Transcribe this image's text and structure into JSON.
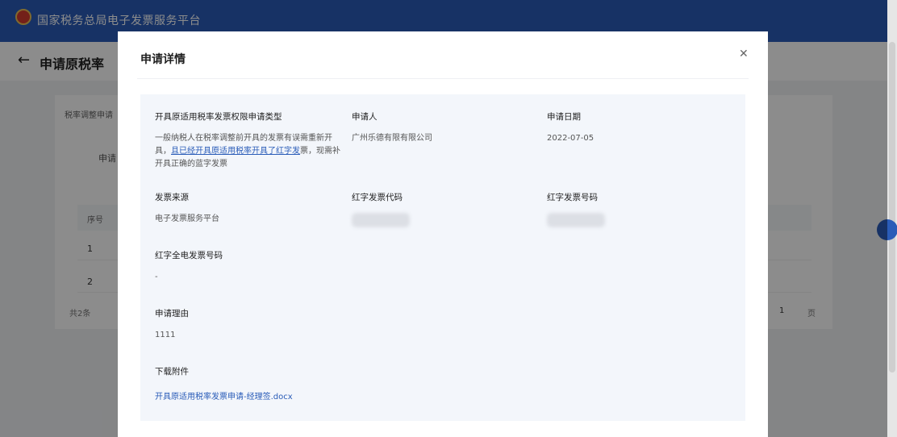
{
  "app": {
    "title": "国家税务总局电子发票服务平台"
  },
  "page": {
    "title": "申请原税率"
  },
  "background": {
    "tab_label": "税率调整申请",
    "field_label": "申请",
    "table_header_index": "序号",
    "rows": [
      "1",
      "2"
    ],
    "total": "共2条",
    "pager_current": "1",
    "pager_next": "页"
  },
  "dialog": {
    "title": "申请详情",
    "close_icon": "close-icon",
    "fields": {
      "issue_type": {
        "label": "开具原适用税率发票权限申请类型",
        "value_part1": "一般纳税人在税率调整前开具的发票有误需重新开具，",
        "value_link": "且已经开具原适用税率开具了红字发",
        "value_part2": "票，现需补开具正确的蓝字发票"
      },
      "applicant": {
        "label": "申请人",
        "value": "广州乐德有限有限公司"
      },
      "apply_date": {
        "label": "申请日期",
        "value": "2022-07-05"
      },
      "invoice_source": {
        "label": "发票来源",
        "value": "电子发票服务平台"
      },
      "red_invoice_code": {
        "label": "红字发票代码"
      },
      "red_invoice_number": {
        "label": "红字发票号码"
      },
      "red_full_invoice_number": {
        "label": "红字全电发票号码",
        "value": "-"
      },
      "reason": {
        "label": "申请理由",
        "value": "1111"
      },
      "attachment": {
        "label": "下载附件",
        "value": "开具原适用税率发票申请-经理签.docx"
      }
    }
  }
}
